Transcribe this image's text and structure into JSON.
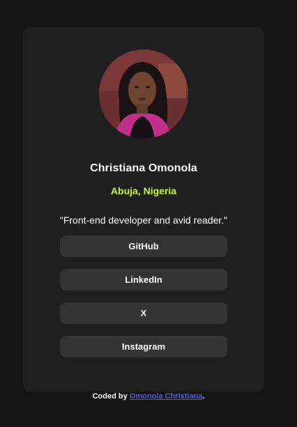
{
  "profile": {
    "name": "Christiana Omonola",
    "location": "Abuja, Nigeria",
    "bio": "\"Front-end developer and avid reader.\""
  },
  "links": {
    "github": "GitHub",
    "linkedin": "LinkedIn",
    "x": "X",
    "instagram": "Instagram"
  },
  "footer": {
    "prefix": "Coded by",
    "author_link": "Omonola Christiana",
    "suffix": "."
  },
  "colors": {
    "background": "#141414",
    "card": "#1f1f1f",
    "button": "#333333",
    "accent": "#c5f82a",
    "link": "#4a5cd6"
  }
}
